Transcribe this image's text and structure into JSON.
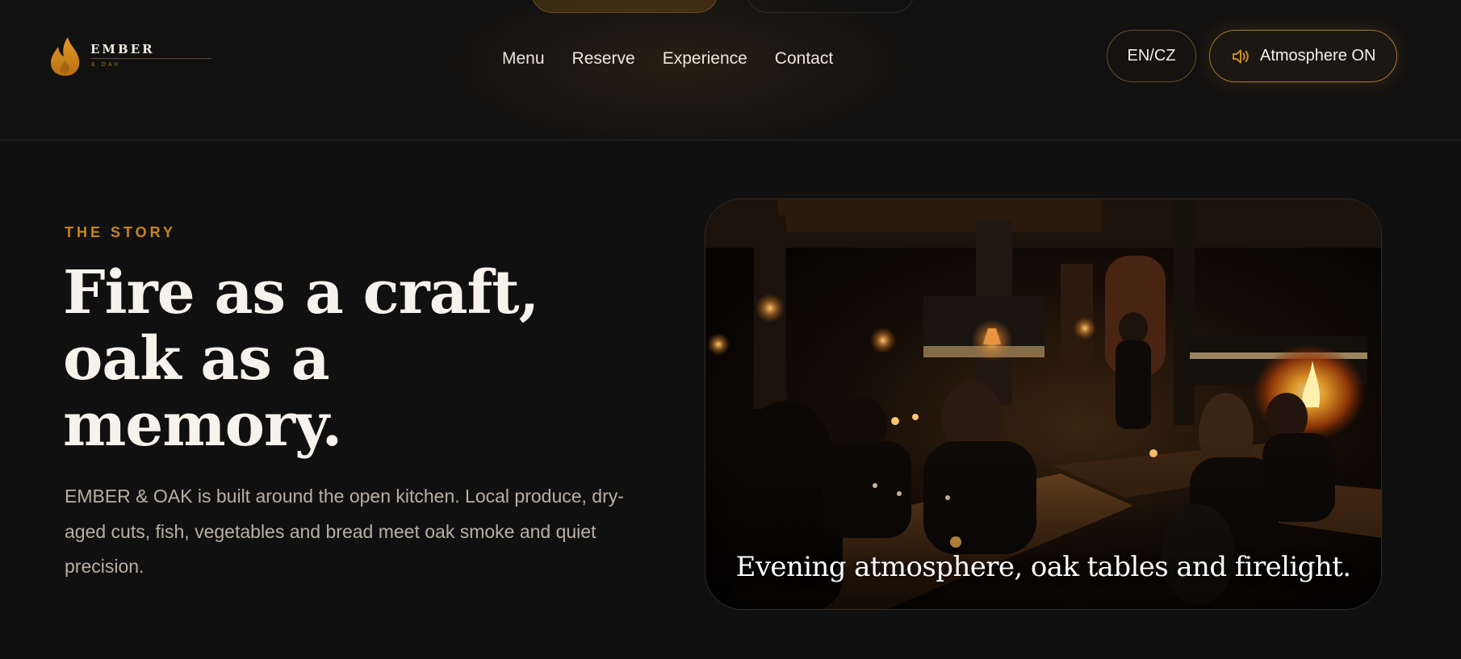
{
  "header": {
    "logo": {
      "wordmark": "EMBER",
      "subline": "& OAK"
    },
    "nav": [
      {
        "label": "Menu"
      },
      {
        "label": "Reserve"
      },
      {
        "label": "Experience"
      },
      {
        "label": "Contact"
      }
    ],
    "language_button": "EN/CZ",
    "atmosphere_button": "Atmosphere ON",
    "accent_color": "#c98322"
  },
  "hero": {
    "eyebrow": "THE STORY",
    "headline_lines": [
      "Fire as a craft,",
      "oak as a",
      "memory."
    ],
    "body": "EMBER & OAK is built around the open kitchen. Local produce, dry-aged cuts, fish, vegetables and bread meet oak smoke and quiet precision.",
    "photo_caption": "Evening atmosphere, oak tables and firelight."
  }
}
